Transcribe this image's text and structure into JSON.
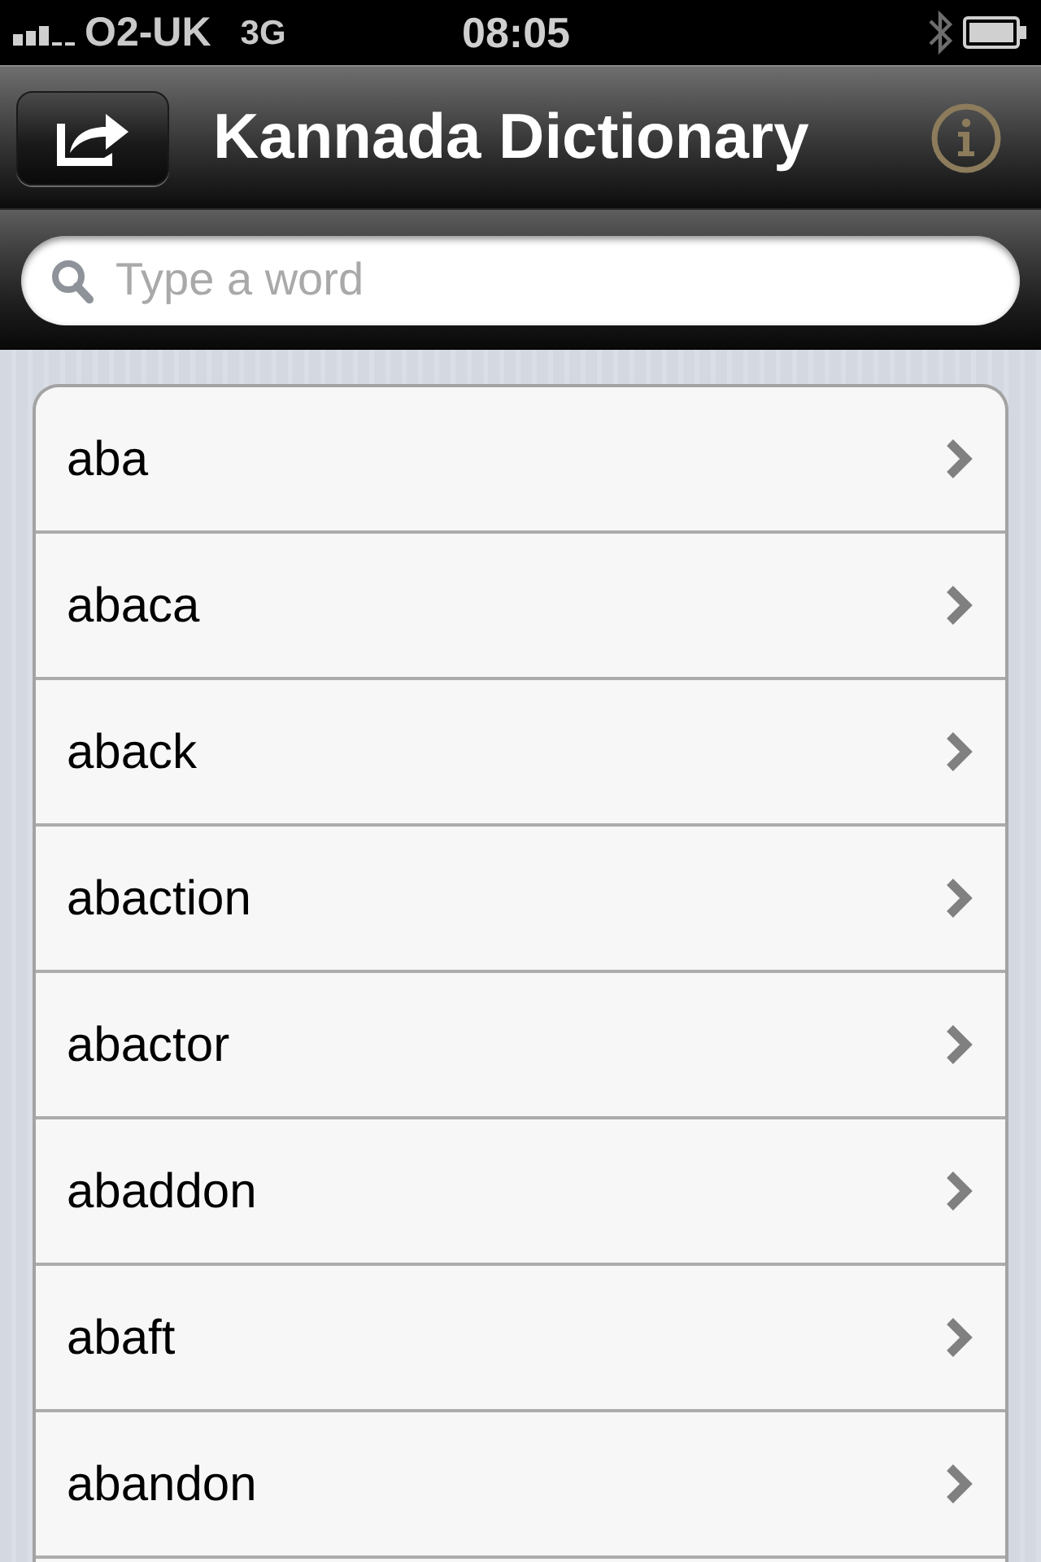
{
  "status_bar": {
    "carrier": "O2-UK",
    "network": "3G",
    "time": "08:05"
  },
  "nav_bar": {
    "title": "Kannada Dictionary"
  },
  "search": {
    "placeholder": "Type a word"
  },
  "words": [
    {
      "label": "aba"
    },
    {
      "label": "abaca"
    },
    {
      "label": "aback"
    },
    {
      "label": "abaction"
    },
    {
      "label": "abactor"
    },
    {
      "label": "abaddon"
    },
    {
      "label": "abaft"
    },
    {
      "label": "abandon"
    }
  ]
}
